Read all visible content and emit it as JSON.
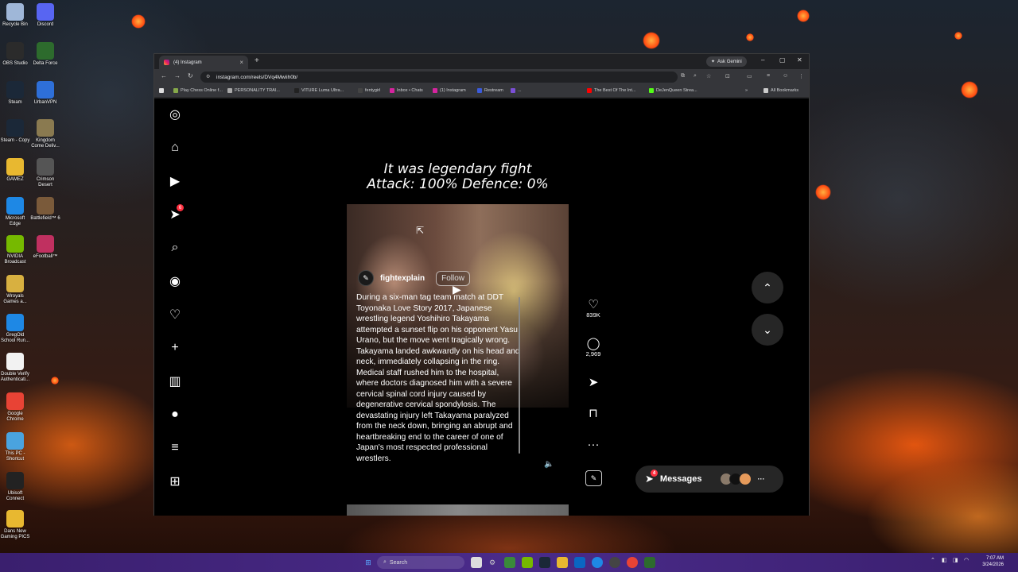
{
  "desktop": {
    "icons": [
      {
        "label": "Recycle Bin",
        "icon": "recycle-bin-icon",
        "color": "#9fb7d8"
      },
      {
        "label": "Discord",
        "icon": "discord-icon",
        "color": "#5865f2"
      },
      {
        "label": "OBS Studio",
        "icon": "obs-icon",
        "color": "#2b2b2b"
      },
      {
        "label": "Delta Force",
        "icon": "delta-force-icon",
        "color": "#2d6b2d"
      },
      {
        "label": "Steam",
        "icon": "steam-icon",
        "color": "#1b2838"
      },
      {
        "label": "UrbanVPN",
        "icon": "urbanvpn-icon",
        "color": "#2e6fd8"
      },
      {
        "label": "Steam - Copy",
        "icon": "steam-icon",
        "color": "#1b2838"
      },
      {
        "label": "Kingdom Come Deliv...",
        "icon": "kingdom-come-icon",
        "color": "#8a7a50"
      },
      {
        "label": "GAMEZ",
        "icon": "folder-icon",
        "color": "#e8b830"
      },
      {
        "label": "Crimson Desert",
        "icon": "crimson-desert-icon",
        "color": "#555"
      },
      {
        "label": "Microsoft Edge",
        "icon": "edge-icon",
        "color": "#1e88e5"
      },
      {
        "label": "Battlefield™ 6",
        "icon": "battlefield-icon",
        "color": "#7a5a3a"
      },
      {
        "label": "NVIDIA Broadcast",
        "icon": "nvidia-icon",
        "color": "#76b900"
      },
      {
        "label": "eFootball™",
        "icon": "efootball-icon",
        "color": "#c03060"
      },
      {
        "label": "Wroyals Games a...",
        "icon": "folder-icon",
        "color": "#d8b040"
      },
      {
        "label": "GregOld School Run...",
        "icon": "edge-icon",
        "color": "#1e88e5"
      },
      {
        "label": "Double Verify Authenticati...",
        "icon": "document-icon",
        "color": "#f2f2f2"
      },
      {
        "label": "Google Chrome",
        "icon": "chrome-icon",
        "color": "#e84335"
      },
      {
        "label": "This PC - Shortcut",
        "icon": "pc-icon",
        "color": "#4aa3df"
      },
      {
        "label": "Ubisoft Connect",
        "icon": "ubisoft-icon",
        "color": "#222"
      },
      {
        "label": "Dans New Gaming PICS",
        "icon": "folder-icon",
        "color": "#e8b830"
      }
    ]
  },
  "browser": {
    "tab_title": "(4) Instagram",
    "new_tab": "+",
    "ask_gemini": "Ask Gemini",
    "window_controls": {
      "minimize": "–",
      "maximize": "▢",
      "close": "✕"
    },
    "url": "instagram.com/reels/DVq4Mwiih0b/",
    "bookmarks": [
      {
        "label": "Play Chess Online f...",
        "color": "#86a94a"
      },
      {
        "label": "PERSONALITY TRAI...",
        "color": "#aaaaaa"
      },
      {
        "label": "VITURE Luma Ultra...",
        "color": "#222222"
      },
      {
        "label": "fentygirl",
        "color": "#444444"
      },
      {
        "label": "Inbox • Chats",
        "color": "#d6249f"
      },
      {
        "label": "(1) Instagram",
        "color": "#d6249f"
      },
      {
        "label": "Restream",
        "color": "#3b5bdb"
      },
      {
        "label": "...",
        "color": "#7b4fd6"
      },
      {
        "label": "The Best Of The Int...",
        "color": "#ff0000"
      },
      {
        "label": "DeJenQueen Strea...",
        "color": "#53fc18"
      }
    ],
    "all_bookmarks": "All Bookmarks"
  },
  "instagram": {
    "nav": [
      {
        "name": "instagram-logo-icon",
        "glyph": "◎"
      },
      {
        "name": "home-icon",
        "glyph": "⌂"
      },
      {
        "name": "reels-icon",
        "glyph": "▶"
      },
      {
        "name": "messages-icon",
        "glyph": "➤",
        "badge": "6"
      },
      {
        "name": "search-icon",
        "glyph": "⌕"
      },
      {
        "name": "explore-icon",
        "glyph": "◉"
      },
      {
        "name": "notifications-icon",
        "glyph": "♡"
      },
      {
        "name": "create-icon",
        "glyph": "+"
      },
      {
        "name": "dashboard-icon",
        "glyph": "▥"
      },
      {
        "name": "profile-avatar-icon",
        "glyph": "●"
      },
      {
        "name": "more-menu-icon",
        "glyph": "≡"
      },
      {
        "name": "also-from-meta-icon",
        "glyph": "⊞"
      }
    ],
    "reel": {
      "overlay_line1": "It was legendary fight",
      "overlay_line2": "Attack: 100% Defence: 0%",
      "username": "fightexplain",
      "follow": "Follow",
      "description": "During a six-man tag team match at DDT Toyonaka Love Story 2017, Japanese wrestling legend Yoshihiro Takayama attempted a sunset flip on his opponent Yasu Urano, but the move went tragically wrong. Takayama landed awkwardly on his head and neck, immediately collapsing in the ring. Medical staff rushed him to the hospital, where doctors diagnosed him with a severe cervical spinal cord injury caused by degenerative cervical spondylosis. The devastating injury left Takayama paralyzed from the neck down, bringing an abrupt and heartbreaking end to the career of one of Japan's most respected professional wrestlers."
    },
    "actions": {
      "likes": "839K",
      "comments": "2,969"
    },
    "messages_pill": {
      "label": "Messages",
      "badge": "4"
    }
  },
  "taskbar": {
    "search_placeholder": "Search",
    "time": "7:07 AM",
    "date": "3/24/2026"
  }
}
